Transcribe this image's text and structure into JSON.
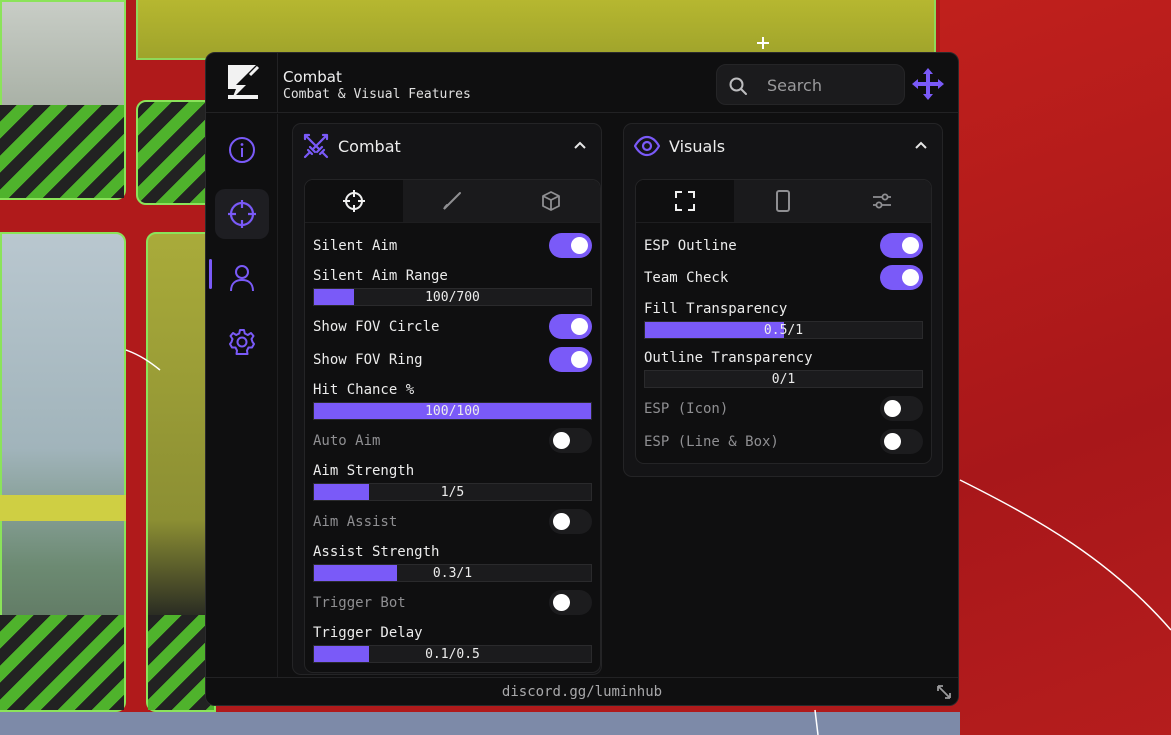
{
  "header": {
    "title": "Combat",
    "subtitle": "Combat & Visual Features",
    "search_placeholder": "Search"
  },
  "colors": {
    "accent": "#7a5af8",
    "window_bg": "#0f0f10",
    "card_bg": "#141416"
  },
  "sidebar": {
    "items": [
      {
        "icon": "info-icon",
        "active": false
      },
      {
        "icon": "crosshair-icon",
        "active": true
      },
      {
        "icon": "user-icon",
        "active": false
      },
      {
        "icon": "gear-icon",
        "active": false
      }
    ]
  },
  "combat": {
    "title": "Combat",
    "tabs": [
      "crosshair-icon",
      "brush-icon",
      "cube-icon"
    ],
    "silent_aim": {
      "label": "Silent Aim",
      "on": true
    },
    "silent_aim_range": {
      "label": "Silent Aim Range",
      "text": "100/700",
      "value": 100,
      "max": 700
    },
    "show_fov_circle": {
      "label": "Show FOV Circle",
      "on": true
    },
    "show_fov_ring": {
      "label": "Show FOV Ring",
      "on": true
    },
    "hit_chance": {
      "label": "Hit Chance %",
      "text": "100/100",
      "value": 100,
      "max": 100
    },
    "auto_aim": {
      "label": "Auto Aim",
      "on": false
    },
    "aim_strength": {
      "label": "Aim Strength",
      "text": "1/5",
      "value": 1,
      "max": 5
    },
    "aim_assist": {
      "label": "Aim Assist",
      "on": false
    },
    "assist_strength": {
      "label": "Assist Strength",
      "text": "0.3/1",
      "value": 0.3,
      "max": 1
    },
    "trigger_bot": {
      "label": "Trigger Bot",
      "on": false
    },
    "trigger_delay": {
      "label": "Trigger Delay",
      "text": "0.1/0.5",
      "value": 0.1,
      "max": 0.5
    }
  },
  "visuals": {
    "title": "Visuals",
    "tabs": [
      "fullscreen-icon",
      "phone-icon",
      "sliders-icon"
    ],
    "esp_outline": {
      "label": "ESP Outline",
      "on": true
    },
    "team_check": {
      "label": "Team Check",
      "on": true
    },
    "fill_transparency": {
      "label": "Fill Transparency",
      "text": "0.5/1",
      "value": 0.5,
      "max": 1
    },
    "outline_transparency": {
      "label": "Outline Transparency",
      "text": "0/1",
      "value": 0,
      "max": 1
    },
    "esp_icon": {
      "label": "ESP (Icon)",
      "on": false
    },
    "esp_line_box": {
      "label": "ESP (Line & Box)",
      "on": false
    }
  },
  "footer": {
    "link": "discord.gg/luminhub"
  }
}
